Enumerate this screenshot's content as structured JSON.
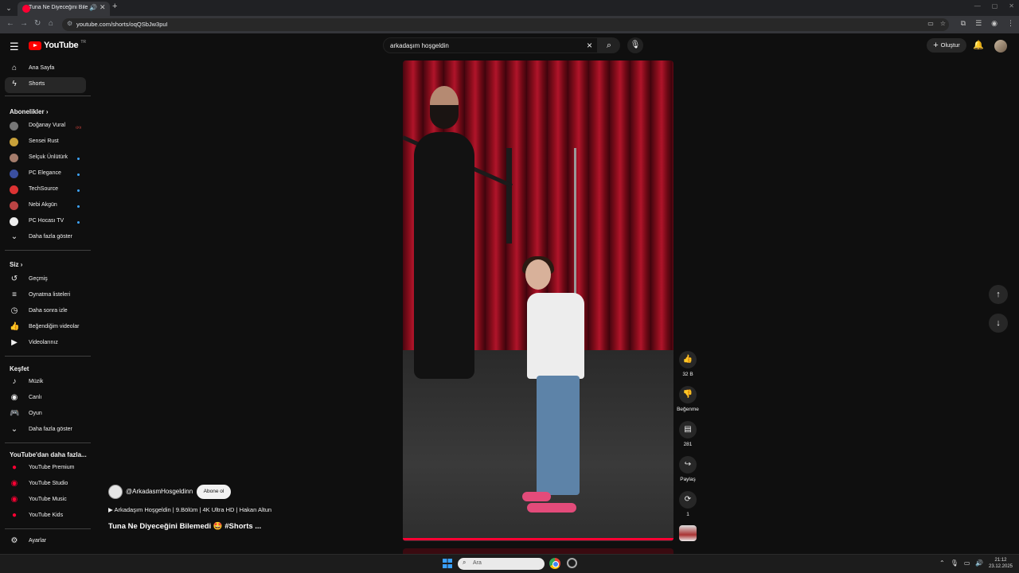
{
  "browser": {
    "tab_title": "Tuna Ne Diyeceğini Bilemedi",
    "url": "youtube.com/shorts/oqQSbJw3puI",
    "new_tab": "+",
    "window_controls": [
      "—",
      "▢",
      "✕"
    ]
  },
  "masthead": {
    "logo_text": "YouTube",
    "region": "TR",
    "search_value": "arkadaşım hoşgeldin",
    "create_label": "Oluştur"
  },
  "sidebar": {
    "top_items": [
      {
        "label": "Ana Sayfa",
        "icon": "home-icon"
      },
      {
        "label": "Shorts",
        "icon": "shorts-icon"
      }
    ],
    "subscriptions_heading": "Abonelikler",
    "subscriptions": [
      {
        "label": "Doğanay Vural",
        "status": "live"
      },
      {
        "label": "Sensei Rust",
        "status": ""
      },
      {
        "label": "Selçuk Ünlütürk",
        "status": "new"
      },
      {
        "label": "PC Elegance",
        "status": "new"
      },
      {
        "label": "TechSource",
        "status": "new"
      },
      {
        "label": "Nebi Akgün",
        "status": "new"
      },
      {
        "label": "PC Hocası TV",
        "status": "new"
      }
    ],
    "more_subscriptions": "Daha fazla göster",
    "you_heading": "Siz",
    "you_items": [
      {
        "label": "Geçmiş",
        "icon": "history-icon"
      },
      {
        "label": "Oynatma listeleri",
        "icon": "playlist-icon"
      },
      {
        "label": "Daha sonra izle",
        "icon": "clock-icon"
      },
      {
        "label": "Beğendiğim videolar",
        "icon": "like-icon"
      },
      {
        "label": "Videolarınız",
        "icon": "video-icon"
      }
    ],
    "explore_heading": "Keşfet",
    "explore_items": [
      {
        "label": "Müzik",
        "icon": "music-icon"
      },
      {
        "label": "Canlı",
        "icon": "live-icon"
      },
      {
        "label": "Oyun",
        "icon": "gaming-icon"
      }
    ],
    "more_explore": "Daha fazla göster",
    "more_yt_heading": "YouTube'dan daha fazla...",
    "more_yt_items": [
      {
        "label": "YouTube Premium"
      },
      {
        "label": "YouTube Studio"
      },
      {
        "label": "YouTube Music"
      },
      {
        "label": "YouTube Kids"
      }
    ],
    "settings": "Ayarlar"
  },
  "short": {
    "channel": "@ArkadasmHosgeldinn",
    "subscribe_label": "Abone ol",
    "description": "▶ Arkadaşım Hoşgeldin | 9.Bölüm | 4K Ultra HD | Hakan Altun",
    "title": "Tuna Ne Diyeceğini Bilemedi 🤩 #Shorts ...",
    "progress": 1.0
  },
  "actions": {
    "like_count": "32 B",
    "dislike_label": "Beğenme",
    "comment_count": "281",
    "share_label": "Paylaş",
    "remix_count": "1"
  },
  "taskbar": {
    "search_placeholder": "Ara",
    "time": "21:12",
    "date": "23.12.2025"
  },
  "colors": {
    "accent": "#ff0033",
    "background": "#0f0f0f",
    "chip": "#272727"
  }
}
